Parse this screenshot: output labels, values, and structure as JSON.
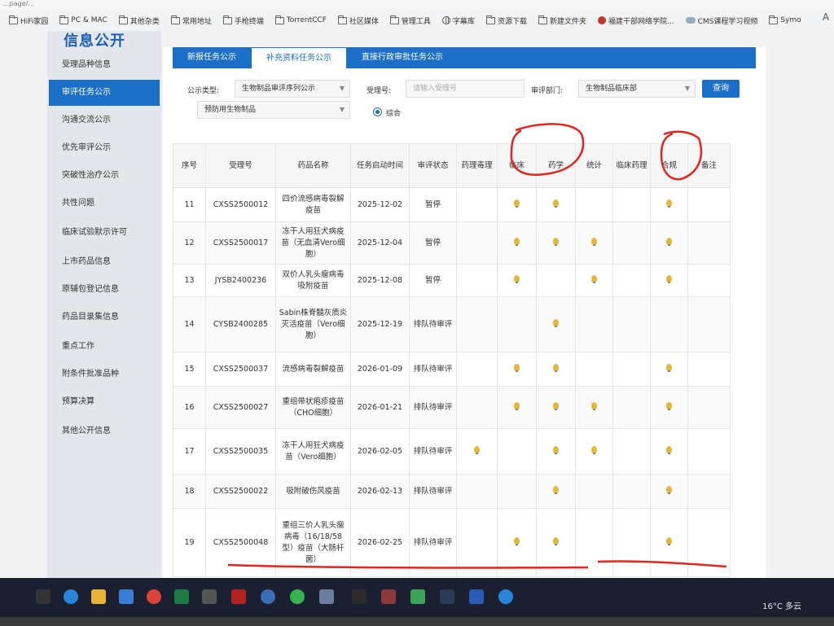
{
  "browser": {
    "url_fragment": "...page/...",
    "bookmarks": [
      {
        "label": "HiFi家园",
        "icon": "folder-icon"
      },
      {
        "label": "PC & MAC",
        "icon": "folder-icon"
      },
      {
        "label": "其他杂类",
        "icon": "folder-icon"
      },
      {
        "label": "常用地址",
        "icon": "folder-icon"
      },
      {
        "label": "手枪终端",
        "icon": "folder-icon"
      },
      {
        "label": "TorrentCCF",
        "icon": "folder-icon"
      },
      {
        "label": "社区媒体",
        "icon": "folder-icon"
      },
      {
        "label": "管理工具",
        "icon": "folder-icon"
      },
      {
        "label": "字幕库",
        "icon": "globe-icon"
      },
      {
        "label": "资源下载",
        "icon": "folder-icon"
      },
      {
        "label": "新建文件夹",
        "icon": "folder-icon"
      },
      {
        "label": "福建干部网络学院...",
        "icon": "red-icon"
      },
      {
        "label": "CMS课程学习视频",
        "icon": "cloud-icon"
      },
      {
        "label": "Symo",
        "icon": "folder-icon"
      }
    ],
    "reader_label": "A"
  },
  "sidebar": {
    "title": "信息公开",
    "items": [
      {
        "label": "受理品种信息",
        "active": false
      },
      {
        "label": "审评任务公示",
        "active": true
      },
      {
        "label": "沟通交流公示",
        "active": false
      },
      {
        "label": "优先审评公示",
        "active": false
      },
      {
        "label": "突破性治疗公示",
        "active": false
      },
      {
        "label": "共性问题",
        "active": false
      },
      {
        "label": "临床试验默示许可",
        "active": false
      },
      {
        "label": "上市药品信息",
        "active": false
      },
      {
        "label": "原辅包登记信息",
        "active": false
      },
      {
        "label": "药品目录集信息",
        "active": false
      },
      {
        "label": "重点工作",
        "active": false
      },
      {
        "label": "附条件批准品种",
        "active": false
      },
      {
        "label": "预算决算",
        "active": false
      },
      {
        "label": "其他公开信息",
        "active": false
      }
    ]
  },
  "tabs": [
    {
      "label": "新报任务公示",
      "active": false
    },
    {
      "label": "补充资料任务公示",
      "active": true
    },
    {
      "label": "直接行政审批任务公示",
      "active": false
    }
  ],
  "filters": {
    "type_label": "公示类型:",
    "type_value": "生物制品审评序列公示",
    "sub_type_value": "预防用生物制品",
    "accept_label": "受理号:",
    "accept_placeholder": "请输入受理号",
    "dept_label": "审评部门:",
    "dept_value": "生物制品临床部",
    "radio_label": "综合",
    "query_label": "查询"
  },
  "table": {
    "headers": [
      "序号",
      "受理号",
      "药品名称",
      "任务启动时间",
      "审评状态",
      "药理毒理",
      "临床",
      "药学",
      "统计",
      "临床药理",
      "合规",
      "备注"
    ],
    "rows": [
      {
        "no": "11",
        "id": "CXSS2500012",
        "name": "四价流感病毒裂解疫苗",
        "date": "2025-12-02",
        "status": "暂停",
        "marks": [
          false,
          true,
          true,
          false,
          false,
          true
        ]
      },
      {
        "no": "12",
        "id": "CXSS2500017",
        "name": "冻干人用狂犬病疫苗（无血清Vero细胞）",
        "date": "2025-12-04",
        "status": "暂停",
        "marks": [
          false,
          true,
          true,
          true,
          false,
          true
        ]
      },
      {
        "no": "13",
        "id": "JYSB2400236",
        "name": "双价人乳头瘤病毒吸附疫苗",
        "date": "2025-12-08",
        "status": "暂停",
        "marks": [
          false,
          true,
          false,
          true,
          false,
          true
        ]
      },
      {
        "no": "14",
        "id": "CYSB2400285",
        "name": "Sabin株脊髓灰质炎灭活疫苗（Vero细胞）",
        "date": "2025-12-19",
        "status": "排队待审评",
        "marks": [
          false,
          false,
          true,
          false,
          false,
          false
        ]
      },
      {
        "no": "15",
        "id": "CXSS2500037",
        "name": "流感病毒裂解疫苗",
        "date": "2026-01-09",
        "status": "排队待审评",
        "marks": [
          false,
          true,
          true,
          false,
          false,
          true
        ]
      },
      {
        "no": "16",
        "id": "CXSS2500027",
        "name": "重组带状疱疹疫苗（CHO细胞）",
        "date": "2026-01-21",
        "status": "排队待审评",
        "marks": [
          false,
          true,
          true,
          true,
          false,
          true
        ]
      },
      {
        "no": "17",
        "id": "CXSS2500035",
        "name": "冻干人用狂犬病疫苗（Vero细胞）",
        "date": "2026-02-05",
        "status": "排队待审评",
        "marks": [
          true,
          false,
          true,
          true,
          false,
          true
        ]
      },
      {
        "no": "18",
        "id": "CXSS2500022",
        "name": "吸附破伤风疫苗",
        "date": "2026-02-13",
        "status": "排队待审评",
        "marks": [
          false,
          false,
          true,
          false,
          false,
          true
        ]
      },
      {
        "no": "19",
        "id": "CXSS2500048",
        "name": "重组三价人乳头瘤病毒（16/18/58型）疫苗（大肠杆菌）",
        "date": "2026-02-25",
        "status": "排队待审评",
        "marks": [
          false,
          true,
          true,
          false,
          false,
          true
        ]
      }
    ]
  },
  "taskbar": {
    "weather": "16°C 多云"
  },
  "colors": {
    "accent": "#1b6fc7",
    "annotation_red": "#e0261e",
    "bulb": "#e2b93b"
  }
}
